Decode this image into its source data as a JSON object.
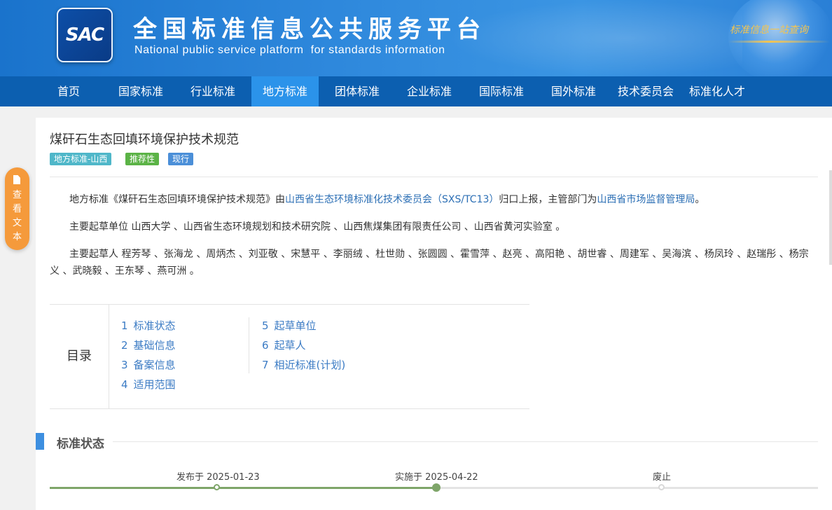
{
  "header": {
    "logo_text": "SAC",
    "title": "全国标准信息公共服务平台",
    "subtitle": "National public service platform  for standards information",
    "slogan": "标准信息一站查询"
  },
  "nav": {
    "items": [
      "首页",
      "国家标准",
      "行业标准",
      "地方标准",
      "团体标准",
      "企业标准",
      "国际标准",
      "国外标准",
      "技术委员会",
      "标准化人才"
    ],
    "active": "地方标准"
  },
  "document": {
    "title": "煤矸石生态回填环境保护技术规范",
    "tags": [
      "地方标准-山西",
      "推荐性",
      "现行"
    ],
    "intro": {
      "prefix": "地方标准《煤矸石生态回填环境保护技术规范》由",
      "committee": "山西省生态环境标准化技术委员会（SXS/TC13）",
      "middle": "归口上报，主管部门为",
      "department": "山西省市场监督管理局",
      "suffix": "。"
    },
    "drafting_units": "主要起草单位 山西大学 、山西省生态环境规划和技术研究院 、山西焦煤集团有限责任公司 、山西省黄河实验室 。",
    "drafters": "主要起草人 程芳琴 、张海龙 、周炳杰 、刘亚敬 、宋慧平 、李丽绒 、杜世勋 、张圆圆 、霍雪萍 、赵亮 、高阳艳 、胡世睿 、周建军 、吴海滨 、杨凤玲 、赵瑞彤 、杨宗义 、武晓毅 、王东琴 、燕可洲 。"
  },
  "toc": {
    "label": "目录",
    "items": [
      {
        "num": "1",
        "label": "标准状态"
      },
      {
        "num": "2",
        "label": "基础信息"
      },
      {
        "num": "3",
        "label": "备案信息"
      },
      {
        "num": "4",
        "label": "适用范围"
      },
      {
        "num": "5",
        "label": "起草单位"
      },
      {
        "num": "6",
        "label": "起草人"
      },
      {
        "num": "7",
        "label": "相近标准(计划)"
      }
    ]
  },
  "status_section": {
    "title": "标准状态",
    "published": "发布于 2025-01-23",
    "implemented": "实施于 2025-04-22",
    "abolished": "废止"
  },
  "float_button": {
    "label": "查看文本"
  },
  "colors": {
    "nav_bg": "#0c5fb0",
    "nav_active": "#2b93ea",
    "link": "#2c6fb5",
    "tag_local": "#4fb7c9",
    "tag_recommended": "#5bb346",
    "tag_current": "#4b8fd8",
    "timeline_done": "#7ea569",
    "float_button": "#f59a3b"
  }
}
